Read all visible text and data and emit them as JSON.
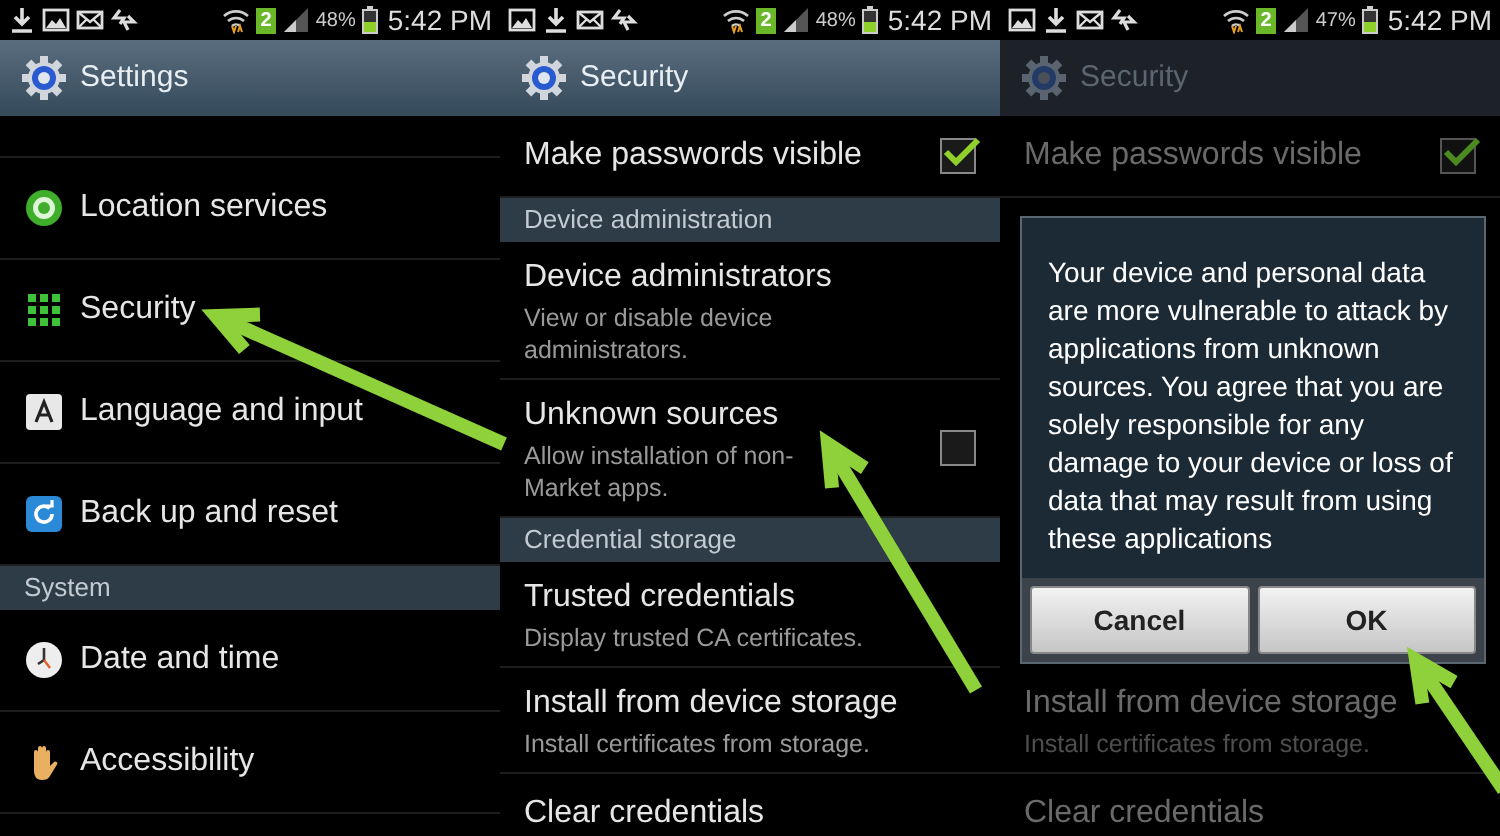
{
  "screens": [
    {
      "dimmed": false,
      "status_bar": {
        "sim_badge": "2",
        "battery": "48%",
        "time": "5:42 PM"
      },
      "title": "Settings",
      "rows": [
        {
          "kind": "cut"
        },
        {
          "kind": "item",
          "label": "Location services"
        },
        {
          "kind": "item",
          "label": "Security"
        },
        {
          "kind": "item",
          "label": "Language and input"
        },
        {
          "kind": "item",
          "label": "Back up and reset"
        },
        {
          "kind": "header",
          "label": "System"
        },
        {
          "kind": "item",
          "label": "Date and time"
        },
        {
          "kind": "item",
          "label": "Accessibility"
        }
      ]
    },
    {
      "dimmed": false,
      "status_bar": {
        "sim_badge": "2",
        "battery": "48%",
        "time": "5:42 PM"
      },
      "title": "Security",
      "rows": [
        {
          "kind": "checkbox",
          "label": "Make passwords visible",
          "checked": true
        },
        {
          "kind": "header",
          "label": "Device administration"
        },
        {
          "kind": "item",
          "label": "Device administrators",
          "subtitle": "View or disable device administrators."
        },
        {
          "kind": "checkbox",
          "label": "Unknown sources",
          "subtitle": "Allow installation of non-Market apps.",
          "checked": false
        },
        {
          "kind": "header",
          "label": "Credential storage"
        },
        {
          "kind": "item",
          "label": "Trusted credentials",
          "subtitle": "Display trusted CA certificates."
        },
        {
          "kind": "item",
          "label": "Install from device storage",
          "subtitle": "Install certificates from storage."
        },
        {
          "kind": "item",
          "label": "Clear credentials"
        }
      ]
    },
    {
      "dimmed": true,
      "status_bar": {
        "sim_badge": "2",
        "battery": "47%",
        "time": "5:42 PM"
      },
      "title": "Security",
      "rows": [
        {
          "kind": "checkbox",
          "label": "Make passwords visible",
          "checked": true
        },
        {
          "kind": "item",
          "label": "Install from device storage",
          "subtitle": "Install certificates from storage."
        },
        {
          "kind": "item",
          "label": "Clear credentials"
        }
      ],
      "dialog": {
        "message": "Your device and personal data are more vulnerable to attack by applications from unknown sources. You agree that you are solely responsible for any damage to your device or loss of data that may result from using these applications",
        "buttons": [
          "Cancel",
          "OK"
        ]
      }
    }
  ]
}
